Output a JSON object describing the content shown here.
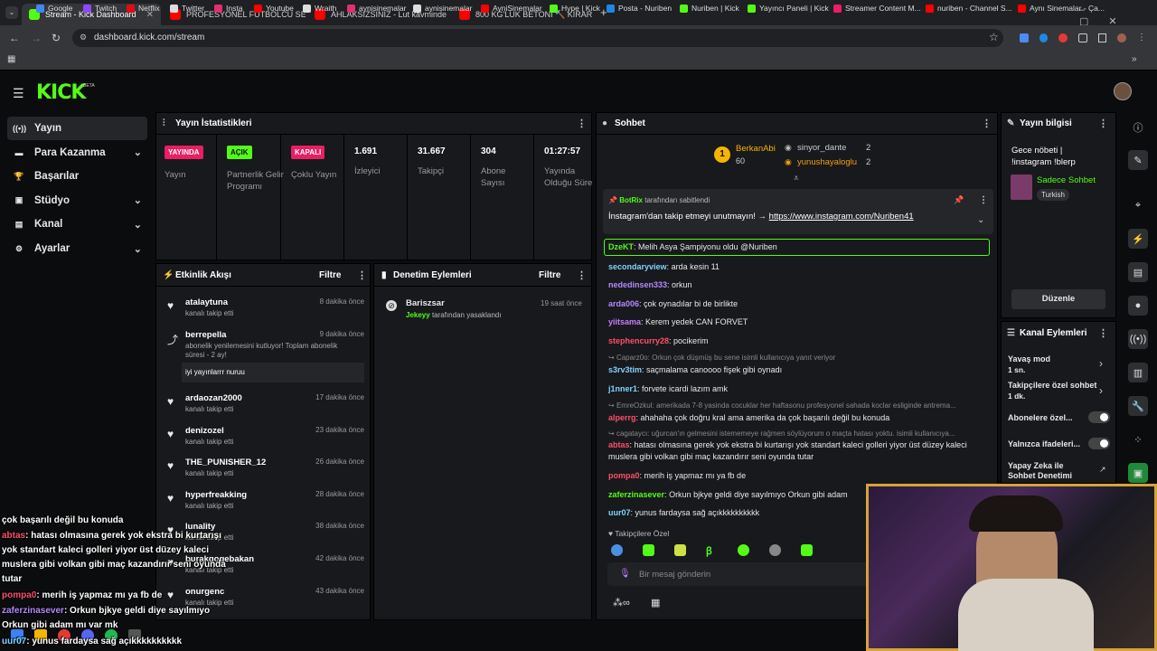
{
  "browser": {
    "tabs": [
      {
        "title": "Stream - Kick Dashboard",
        "favicon_color": "#53fc18",
        "active": true
      },
      {
        "title": "PROFESYONEL FUTBOLCU SENİ",
        "favicon_color": "#ff0000",
        "active": false
      },
      {
        "title": "AHLAKSIZSINIZ - Lut kavminde",
        "favicon_color": "#ff0000",
        "active": false
      },
      {
        "title": "800 KG'LUK BETONI 🔨 KIRAR",
        "favicon_color": "#ff0000",
        "active": false
      }
    ],
    "url": "dashboard.kick.com/stream",
    "bookmarks": [
      "Google",
      "Twitch",
      "Netflix",
      "Twitter",
      "Insta",
      "Youtube",
      "Wraith",
      "aynisinemalar",
      "aynisinemalar",
      "AyniSinemalar",
      "Hype | Kick",
      "Posta - Nuriben",
      "Nuriben | Kick",
      "Yayıncı Paneli | Kick",
      "Streamer Content M...",
      "nuriben - Channel S...",
      "Aynı Sinemalar - Ça..."
    ]
  },
  "sidebar": {
    "items": [
      {
        "label": "Yayın",
        "icon": "broadcast-icon"
      },
      {
        "label": "Para Kazanma",
        "icon": "money-icon"
      },
      {
        "label": "Başarılar",
        "icon": "trophy-icon"
      },
      {
        "label": "Stüdyo",
        "icon": "studio-icon"
      },
      {
        "label": "Kanal",
        "icon": "channel-icon"
      },
      {
        "label": "Ayarlar",
        "icon": "settings-icon"
      }
    ]
  },
  "stats": {
    "title": "Yayın İstatistikleri",
    "badges": [
      {
        "badge": "YAYINDA",
        "label": "Yayın",
        "color": "#e91e63"
      },
      {
        "badge": "AÇIK",
        "label": "Partnerlik Gelir Programı",
        "color": "#53fc18"
      },
      {
        "badge": "KAPALI",
        "label": "Çoklu Yayın",
        "color": "#e91e63"
      }
    ],
    "numbers": [
      {
        "value": "1.691",
        "label": "İzleyici"
      },
      {
        "value": "31.667",
        "label": "Takipçi"
      },
      {
        "value": "304",
        "label": "Abone Sayısı"
      },
      {
        "value": "01:27:57",
        "label": "Yayında Olduğu Süre"
      }
    ]
  },
  "activity": {
    "title": "Etkinlik Akışı",
    "filter": "Filtre",
    "events": [
      {
        "name": "atalaytuna",
        "sub": "kanalı takip etti",
        "time": "8 dakika önce"
      },
      {
        "name": "berrepella",
        "sub": "abonelik yenilemesini kutluyor! Toplam abonelik süresi - 2 ay!",
        "time": "9 dakika önce",
        "msg": "iyi yayınlarrr nuruu"
      },
      {
        "name": "ardaozan2000",
        "sub": "kanalı takip etti",
        "time": "17 dakika önce"
      },
      {
        "name": "denizozel",
        "sub": "kanalı takip etti",
        "time": "23 dakika önce"
      },
      {
        "name": "THE_PUNISHER_12",
        "sub": "kanalı takip etti",
        "time": "26 dakika önce"
      },
      {
        "name": "hyperfreakking",
        "sub": "kanalı takip etti",
        "time": "28 dakika önce"
      },
      {
        "name": "lunality",
        "sub": "kanalı takip etti",
        "time": "38 dakika önce"
      },
      {
        "name": "burakgogebakan",
        "sub": "kanalı takip etti",
        "time": "42 dakika önce"
      },
      {
        "name": "onurgenc",
        "sub": "kanalı takip etti",
        "time": "43 dakika önce"
      }
    ]
  },
  "moderation": {
    "title": "Denetim Eylemleri",
    "filter": "Filtre",
    "items": [
      {
        "name": "Bariszsar",
        "by": "Jekeyy",
        "action": "tarafından yasaklandı",
        "time": "19 saat önce"
      }
    ]
  },
  "chat": {
    "title": "Sohbet",
    "leaders": [
      {
        "name": "BerkanAbi",
        "count": "60"
      },
      {
        "name": "sinyor_dante",
        "count": "2"
      },
      {
        "name": "yunushayaloglu",
        "count": "2"
      }
    ],
    "pinned": {
      "by": "BotRix",
      "by_suffix": "tarafından sabitlendi",
      "text": "İnstagram'dan takip etmeyi unutmayın! →",
      "link": "https://www.instagram.com/Nuriben41"
    },
    "messages": [
      {
        "user": "DzeKT",
        "color": "#53fc18",
        "text": "Melih Asya Şampiyonu oldu @Nuriben"
      },
      {
        "user": "secondaryview",
        "color": "#7fd3ff",
        "text": "arda kesin 11"
      },
      {
        "user": "nededinsen333",
        "color": "#b388ff",
        "text": "orkun"
      },
      {
        "user": "arda006",
        "color": "#b388ff",
        "text": "çok oynadılar bi de birlikte"
      },
      {
        "user": "yiitsama",
        "color": "#c77dff",
        "text": "Kerem yedek CAN FORVET"
      },
      {
        "user": "stephencurry28",
        "color": "#ff4d6d",
        "text": "pocikerim"
      },
      {
        "reply": "Caparz0o: Orkun çok düşmüş bu sene isimli kullanıcıya yanıt veriyor"
      },
      {
        "user": "s3rv3tim",
        "color": "#7fd3ff",
        "text": "saçmalama canoooo fişek gibi oynadı"
      },
      {
        "user": "j1nner1",
        "color": "#7fd3ff",
        "text": "forvete icardi lazım amk"
      },
      {
        "reply": "EmreOzkul: amerikada 7-8 yasinda cocuklar her haftasonu profesyonel sahada koclar esliginde antrema..."
      },
      {
        "user": "alperrg",
        "color": "#ff4d6d",
        "text": "ahahaha çok doğru kral ama amerika da çok başarılı değil bu konuda"
      },
      {
        "reply": "cagataycı: uğurcan'ın gelmesini istememeye rağmen söylüyorum o maçta hatası yoktu. isimli kullanıcıya..."
      },
      {
        "user": "abtas",
        "color": "#ff4d6d",
        "text": "hatası olmasına gerek yok ekstra bi kurtarışı yok standart kaleci golleri yiyor üst düzey kaleci muslera gibi volkan gibi maç kazandırır seni oyunda tutar"
      },
      {
        "user": "pompa0",
        "color": "#ff4d6d",
        "text": "merih iş yapmaz mı ya fb de"
      },
      {
        "user": "zaferzinasever",
        "color": "#53fc18",
        "text": "Orkun bjkye geldi diye sayılmıyo Orkun gibi adam"
      },
      {
        "user": "uur07",
        "color": "#7fd3ff",
        "text": "yunus fardaysa sağ açıkkkkkkkkkk"
      }
    ],
    "followers_only": "Takipçilere Özel",
    "input_placeholder": "Bir mesaj gönderin"
  },
  "stream_info": {
    "title": "Yayın bilgisi",
    "stream_title": "Gece nöbeti | !instagram !blerp",
    "category": "Sadece Sohbet",
    "language": "Turkish",
    "edit": "Düzenle"
  },
  "channel_actions": {
    "title": "Kanal Eylemleri",
    "items": [
      {
        "label": "Yavaş mod",
        "value": "1 sn."
      },
      {
        "label": "Takipçilere özel sohbet",
        "value": "1 dk."
      },
      {
        "label": "Abonelere özel..."
      },
      {
        "label": "Yalnızca ifadeleri..."
      },
      {
        "label": "Yapay Zeka ile Sohbet Denetimi"
      }
    ]
  },
  "overlay_chat": [
    {
      "user": "",
      "text": "çok başarılı değil bu konuda"
    },
    {
      "user": "abtas",
      "text": ": hatası olmasına gerek yok ekstra bi kurtarışı"
    },
    {
      "user": "",
      "text": "yok standart kaleci golleri yiyor üst düzey kaleci"
    },
    {
      "user": "",
      "text": "muslera gibi volkan gibi maç kazandırır seni oyunda"
    },
    {
      "user": "",
      "text": "tutar"
    },
    {
      "user": "pompa0",
      "text": ": merih iş yapmaz mı ya fb de"
    },
    {
      "user": "zaferzinasever",
      "text": ": Orkun bjkye geldi diye sayılmıyo"
    },
    {
      "user": "",
      "text": "Orkun gibi adam mı var mk"
    },
    {
      "user": "uur07",
      "text": ": yunus fardaysa sağ açıkkkkkkkkkk"
    }
  ],
  "colors": {
    "brand": "#53fc18",
    "live": "#e91e63",
    "panel": "#18191c"
  }
}
